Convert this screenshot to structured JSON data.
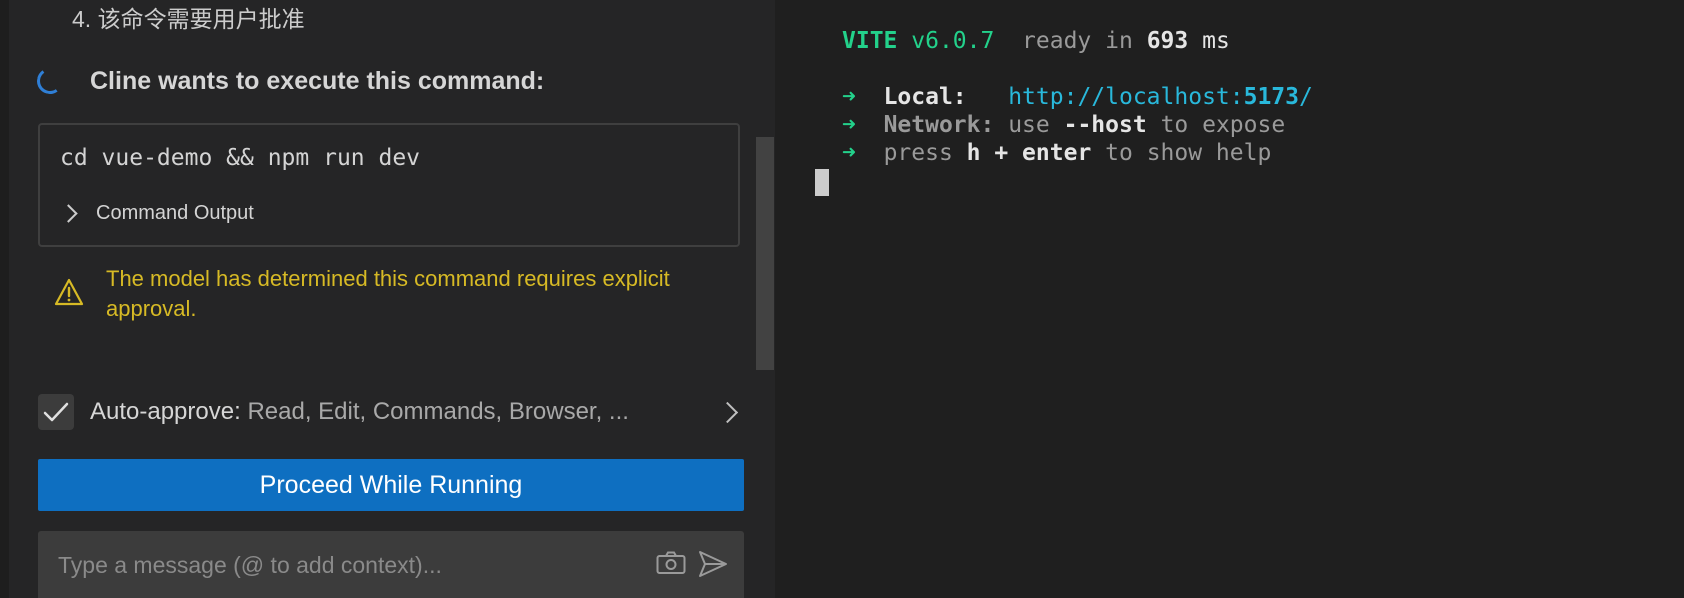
{
  "chat": {
    "step_item": "4. 该命令需要用户批准",
    "command_title": "Cline wants to execute this command:",
    "command_text": "cd vue-demo && npm run dev",
    "command_output_label": "Command Output",
    "warning_text": "The model has determined this command requires explicit approval.",
    "auto_approve_label": "Auto-approve:",
    "auto_approve_items": "Read, Edit, Commands, Browser, ...",
    "proceed_button_label": "Proceed While Running",
    "message_placeholder": "Type a message (@ to add context)...",
    "icons": {
      "spinner": "loading-spinner-icon",
      "output_chevron": "chevron-right-icon",
      "warning": "warning-icon",
      "checkbox": "check-icon",
      "auto_approve_chevron": "chevron-right-icon",
      "camera": "camera-icon",
      "send": "send-icon"
    }
  },
  "terminal": {
    "vite_name": "VITE",
    "vite_version": "v6.0.7",
    "ready_text": "ready in",
    "ready_ms": "693",
    "ms_unit": "ms",
    "arrow": "➜",
    "local_label": "Local:",
    "local_url_prefix": "http://localhost:",
    "local_url_port": "5173",
    "local_url_suffix": "/",
    "network_label": "Network:",
    "network_use": "use",
    "network_flag": "--host",
    "network_rest": "to expose",
    "press": "press",
    "press_keys": "h + enter",
    "press_rest": "to show help"
  },
  "colors": {
    "accent_button": "#0e6fc1",
    "warning": "#d7ba25",
    "terminal_green": "#23d18b",
    "terminal_cyan": "#29b8db",
    "spinner": "#2f7fd6"
  }
}
